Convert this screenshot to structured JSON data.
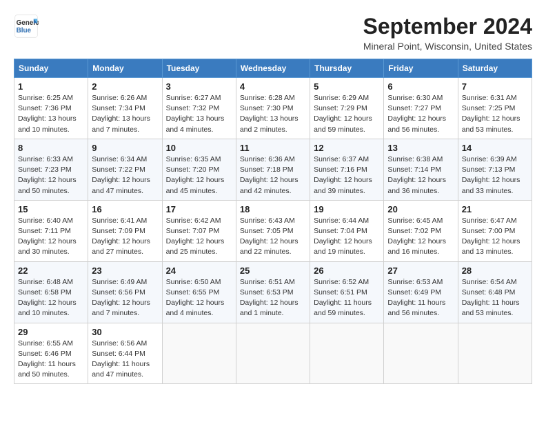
{
  "header": {
    "logo_general": "General",
    "logo_blue": "Blue",
    "title": "September 2024",
    "subtitle": "Mineral Point, Wisconsin, United States"
  },
  "calendar": {
    "days_of_week": [
      "Sunday",
      "Monday",
      "Tuesday",
      "Wednesday",
      "Thursday",
      "Friday",
      "Saturday"
    ],
    "weeks": [
      [
        null,
        {
          "day": "2",
          "sunrise": "6:26 AM",
          "sunset": "7:34 PM",
          "daylight": "13 hours and 7 minutes."
        },
        {
          "day": "3",
          "sunrise": "6:27 AM",
          "sunset": "7:32 PM",
          "daylight": "13 hours and 4 minutes."
        },
        {
          "day": "4",
          "sunrise": "6:28 AM",
          "sunset": "7:30 PM",
          "daylight": "13 hours and 2 minutes."
        },
        {
          "day": "5",
          "sunrise": "6:29 AM",
          "sunset": "7:29 PM",
          "daylight": "12 hours and 59 minutes."
        },
        {
          "day": "6",
          "sunrise": "6:30 AM",
          "sunset": "7:27 PM",
          "daylight": "12 hours and 56 minutes."
        },
        {
          "day": "7",
          "sunrise": "6:31 AM",
          "sunset": "7:25 PM",
          "daylight": "12 hours and 53 minutes."
        }
      ],
      [
        {
          "day": "1",
          "sunrise": "6:25 AM",
          "sunset": "7:36 PM",
          "daylight": "13 hours and 10 minutes."
        },
        {
          "day": "8",
          "sunrise": "6:33 AM",
          "sunset": "7:23 PM",
          "daylight": "12 hours and 50 minutes."
        },
        {
          "day": "9",
          "sunrise": "6:34 AM",
          "sunset": "7:22 PM",
          "daylight": "12 hours and 47 minutes."
        },
        {
          "day": "10",
          "sunrise": "6:35 AM",
          "sunset": "7:20 PM",
          "daylight": "12 hours and 45 minutes."
        },
        {
          "day": "11",
          "sunrise": "6:36 AM",
          "sunset": "7:18 PM",
          "daylight": "12 hours and 42 minutes."
        },
        {
          "day": "12",
          "sunrise": "6:37 AM",
          "sunset": "7:16 PM",
          "daylight": "12 hours and 39 minutes."
        },
        {
          "day": "13",
          "sunrise": "6:38 AM",
          "sunset": "7:14 PM",
          "daylight": "12 hours and 36 minutes."
        },
        {
          "day": "14",
          "sunrise": "6:39 AM",
          "sunset": "7:13 PM",
          "daylight": "12 hours and 33 minutes."
        }
      ],
      [
        {
          "day": "15",
          "sunrise": "6:40 AM",
          "sunset": "7:11 PM",
          "daylight": "12 hours and 30 minutes."
        },
        {
          "day": "16",
          "sunrise": "6:41 AM",
          "sunset": "7:09 PM",
          "daylight": "12 hours and 27 minutes."
        },
        {
          "day": "17",
          "sunrise": "6:42 AM",
          "sunset": "7:07 PM",
          "daylight": "12 hours and 25 minutes."
        },
        {
          "day": "18",
          "sunrise": "6:43 AM",
          "sunset": "7:05 PM",
          "daylight": "12 hours and 22 minutes."
        },
        {
          "day": "19",
          "sunrise": "6:44 AM",
          "sunset": "7:04 PM",
          "daylight": "12 hours and 19 minutes."
        },
        {
          "day": "20",
          "sunrise": "6:45 AM",
          "sunset": "7:02 PM",
          "daylight": "12 hours and 16 minutes."
        },
        {
          "day": "21",
          "sunrise": "6:47 AM",
          "sunset": "7:00 PM",
          "daylight": "12 hours and 13 minutes."
        }
      ],
      [
        {
          "day": "22",
          "sunrise": "6:48 AM",
          "sunset": "6:58 PM",
          "daylight": "12 hours and 10 minutes."
        },
        {
          "day": "23",
          "sunrise": "6:49 AM",
          "sunset": "6:56 PM",
          "daylight": "12 hours and 7 minutes."
        },
        {
          "day": "24",
          "sunrise": "6:50 AM",
          "sunset": "6:55 PM",
          "daylight": "12 hours and 4 minutes."
        },
        {
          "day": "25",
          "sunrise": "6:51 AM",
          "sunset": "6:53 PM",
          "daylight": "12 hours and 1 minute."
        },
        {
          "day": "26",
          "sunrise": "6:52 AM",
          "sunset": "6:51 PM",
          "daylight": "11 hours and 59 minutes."
        },
        {
          "day": "27",
          "sunrise": "6:53 AM",
          "sunset": "6:49 PM",
          "daylight": "11 hours and 56 minutes."
        },
        {
          "day": "28",
          "sunrise": "6:54 AM",
          "sunset": "6:48 PM",
          "daylight": "11 hours and 53 minutes."
        }
      ],
      [
        {
          "day": "29",
          "sunrise": "6:55 AM",
          "sunset": "6:46 PM",
          "daylight": "11 hours and 50 minutes."
        },
        {
          "day": "30",
          "sunrise": "6:56 AM",
          "sunset": "6:44 PM",
          "daylight": "11 hours and 47 minutes."
        },
        null,
        null,
        null,
        null,
        null
      ]
    ]
  }
}
